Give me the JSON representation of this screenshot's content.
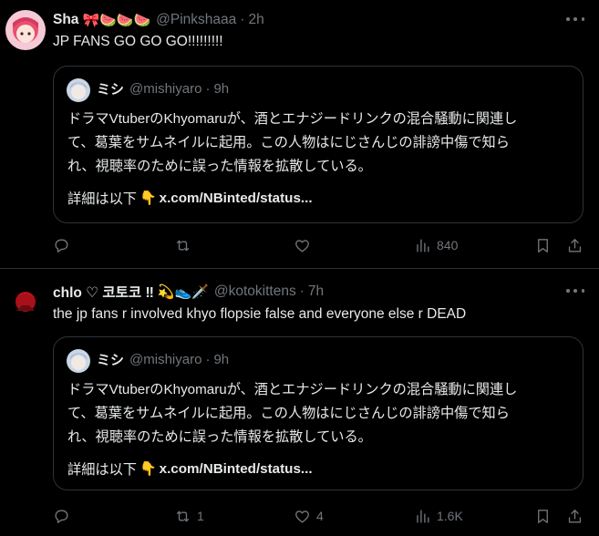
{
  "posts": [
    {
      "author": {
        "name": "Sha",
        "emojis": "🎀🍉🍉🍉",
        "handle": "@Pinkshaaa",
        "separator": "·",
        "time": "2h"
      },
      "text": "JP FANS GO GO GO!!!!!!!!!",
      "quote": {
        "name": "ミシ",
        "handle": "@mishiyaro",
        "separator": "·",
        "time": "9h",
        "lines": [
          "ドラマVtuberのKhyomaruが、酒とエナジードリンクの混合騒動に関連し",
          "て、葛葉をサムネイルに起用。この人物はにじさんじの誹謗中傷で知ら",
          "れ、視聴率のために誤った情報を拡散している。"
        ],
        "details_label": "詳細は以下",
        "details_emoji": "👇",
        "link": "x.com/NBinted/status..."
      },
      "actions": {
        "reply_icon": "reply-icon",
        "repost_icon": "repost-icon",
        "like_icon": "heart-icon",
        "views_icon": "views-chart-icon",
        "views": "840",
        "bookmark_icon": "bookmark-icon",
        "share_icon": "share-icon"
      }
    },
    {
      "author": {
        "name": "chlo ♡ 코토코 ‼",
        "emojis": "💫👟🗡️",
        "handle": "@kotokittens",
        "separator": "·",
        "time": "7h"
      },
      "text": "the jp fans r involved khyo flopsie false and everyone else r DEAD",
      "quote": {
        "name": "ミシ",
        "handle": "@mishiyaro",
        "separator": "·",
        "time": "9h",
        "lines": [
          "ドラマVtuberのKhyomaruが、酒とエナジードリンクの混合騒動に関連し",
          "て、葛葉をサムネイルに起用。この人物はにじさんじの誹謗中傷で知ら",
          "れ、視聴率のために誤った情報を拡散している。"
        ],
        "details_label": "詳細は以下",
        "details_emoji": "👇",
        "link": "x.com/NBinted/status..."
      },
      "actions": {
        "reply_icon": "reply-icon",
        "repost_icon": "repost-icon",
        "reposts": "1",
        "like_icon": "heart-icon",
        "likes": "4",
        "views_icon": "views-chart-icon",
        "views": "1.6K",
        "bookmark_icon": "bookmark-icon",
        "share_icon": "share-icon"
      }
    }
  ],
  "colors": {
    "background": "#000000",
    "text": "#e7e9ea",
    "secondary": "#71767b",
    "border": "#2f3336"
  }
}
